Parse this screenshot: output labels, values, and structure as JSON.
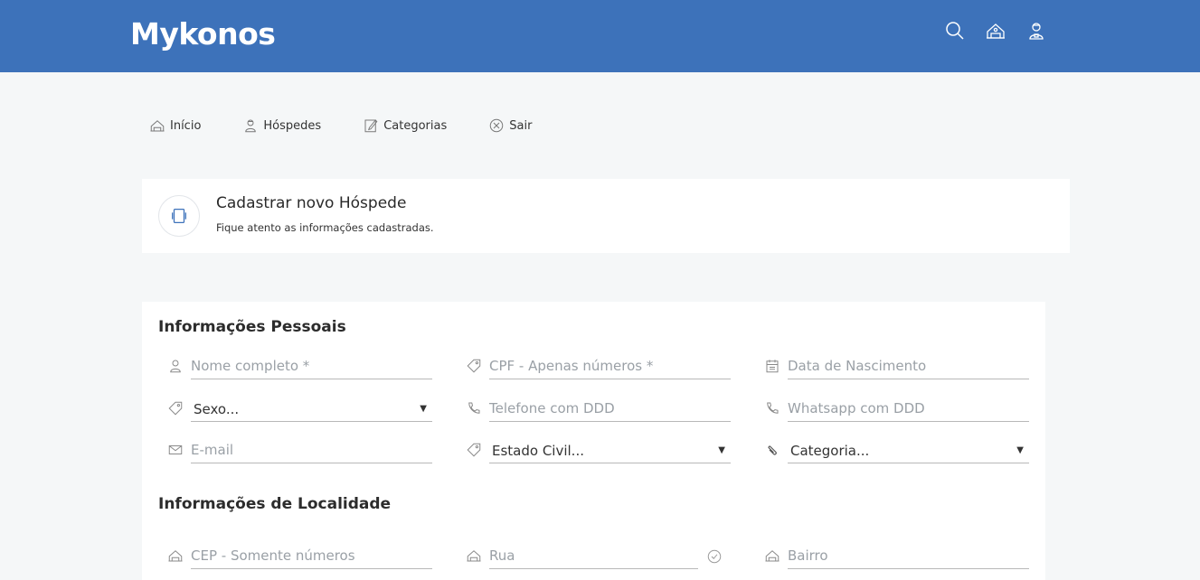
{
  "app": {
    "brand": "Mykonos"
  },
  "topbar": {
    "icons": [
      "search-icon",
      "hotel-icon",
      "guest-icon"
    ]
  },
  "nav": {
    "items": [
      {
        "label": "Início",
        "icon": "hotel-icon"
      },
      {
        "label": "Hóspedes",
        "icon": "guest-icon"
      },
      {
        "label": "Categorias",
        "icon": "edit-icon"
      },
      {
        "label": "Sair",
        "icon": "close-circle-icon"
      }
    ]
  },
  "header": {
    "title": "Cadastrar novo Hóspede",
    "subtitle": "Fique atento as informações cadastradas.",
    "icon": "card-icon"
  },
  "personal": {
    "title": "Informações Pessoais",
    "nome_placeholder": "Nome completo *",
    "cpf_placeholder": "CPF - Apenas números *",
    "nascimento_placeholder": "Data de Nascimento",
    "sexo_value": "Sexo...",
    "telefone_placeholder": "Telefone com DDD",
    "whatsapp_placeholder": "Whatsapp com DDD",
    "email_placeholder": "E-mail",
    "estado_civil_value": "Estado Civil...",
    "categoria_value": "Categoria..."
  },
  "location": {
    "title": "Informações de Localidade",
    "cep_placeholder": "CEP - Somente números",
    "rua_placeholder": "Rua",
    "bairro_placeholder": "Bairro"
  },
  "colors": {
    "topbar": "#3d72ba",
    "background": "#f5f7f8"
  }
}
